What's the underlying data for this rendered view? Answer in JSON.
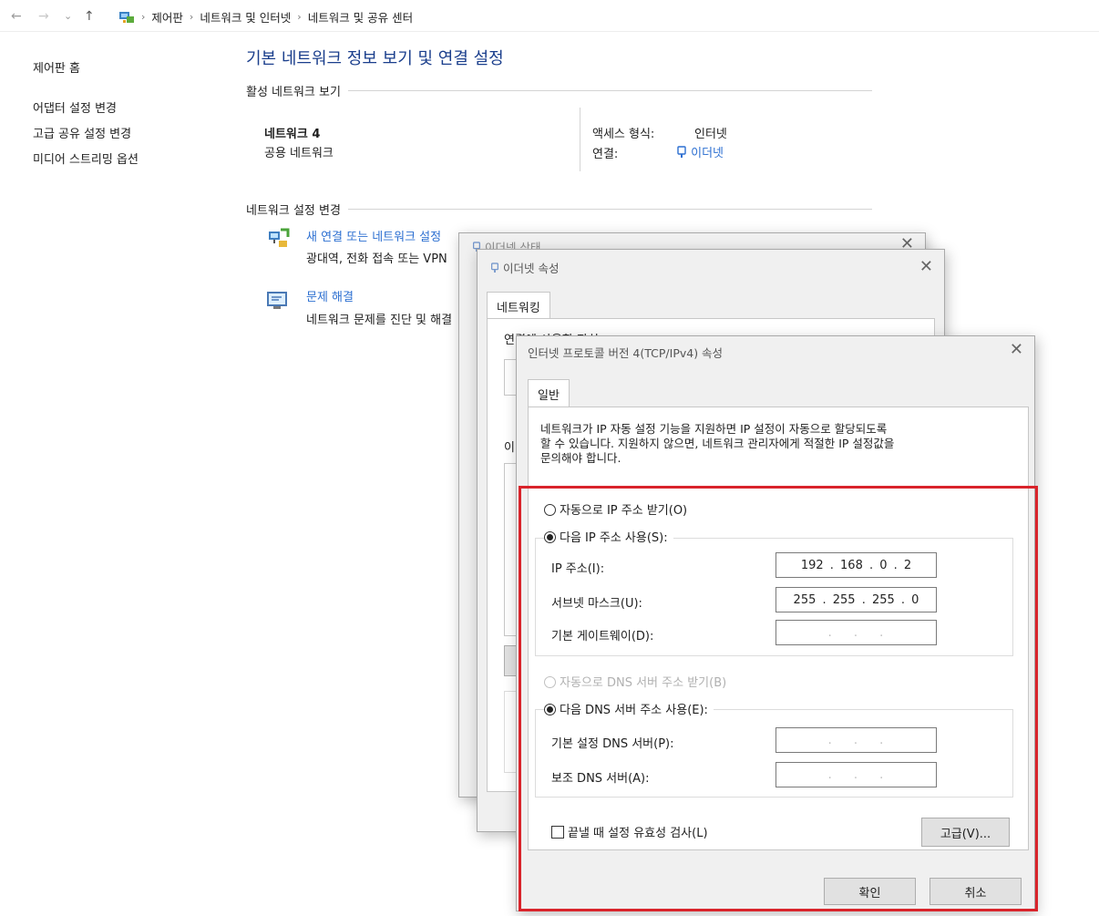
{
  "nav": {
    "back": "←",
    "forward": "→",
    "recent": "⌄",
    "up": "↑",
    "breadcrumb": [
      "제어판",
      "네트워크 및 인터넷",
      "네트워크 및 공유 센터"
    ]
  },
  "sidebar": {
    "home": "제어판 홈",
    "links": [
      "어댑터 설정 변경",
      "고급 공유 설정 변경",
      "미디어 스트리밍 옵션"
    ]
  },
  "main": {
    "title": "기본 네트워크 정보 보기 및 연결 설정",
    "active_section": "활성 네트워크 보기",
    "network_name": "네트워크 4",
    "network_type": "공용 네트워크",
    "access_label": "액세스 형식:",
    "access_value": "인터넷",
    "connection_label": "연결:",
    "connection_value": "이더넷",
    "change_section": "네트워크 설정 변경",
    "new_connection_link": "새 연결 또는 네트워크 설정",
    "new_connection_desc": "광대역, 전화 접속 또는 VPN",
    "troubleshoot_link": "문제 해결",
    "troubleshoot_desc": "네트워크 문제를 진단 및 해결"
  },
  "status_dialog": {
    "title": "이더넷 상태"
  },
  "props_dialog": {
    "title": "이더넷 속성",
    "tab": "네트워킹",
    "connect_using": "연결에 사용할 장치:",
    "items_label": "이"
  },
  "ipv4_dialog": {
    "title": "인터넷 프로토콜 버전 4(TCP/IPv4) 속성",
    "tab": "일반",
    "description": [
      "네트워크가 IP 자동 설정 기능을 지원하면 IP 설정이 자동으로 할당되도록",
      "할 수 있습니다. 지원하지 않으면, 네트워크 관리자에게 적절한 IP 설정값을",
      "문의해야 합니다."
    ],
    "auto_ip": "자동으로 IP 주소 받기(O)",
    "manual_ip": "다음 IP 주소 사용(S):",
    "ip_label": "IP 주소(I):",
    "ip_value": "192 . 168 . 0 . 2",
    "subnet_label": "서브넷 마스크(U):",
    "subnet_value": "255 . 255 . 255 . 0",
    "gateway_label": "기본 게이트웨이(D):",
    "empty_ip": ". . .",
    "auto_dns": "자동으로 DNS 서버 주소 받기(B)",
    "manual_dns": "다음 DNS 서버 주소 사용(E):",
    "pref_dns_label": "기본 설정 DNS 서버(P):",
    "alt_dns_label": "보조 DNS 서버(A):",
    "validate": "끝낼 때 설정 유효성 검사(L)",
    "advanced": "고급(V)...",
    "ok": "확인",
    "cancel": "취소"
  },
  "colors": {
    "link": "#2c6fd1",
    "highlight": "#d9242b"
  }
}
